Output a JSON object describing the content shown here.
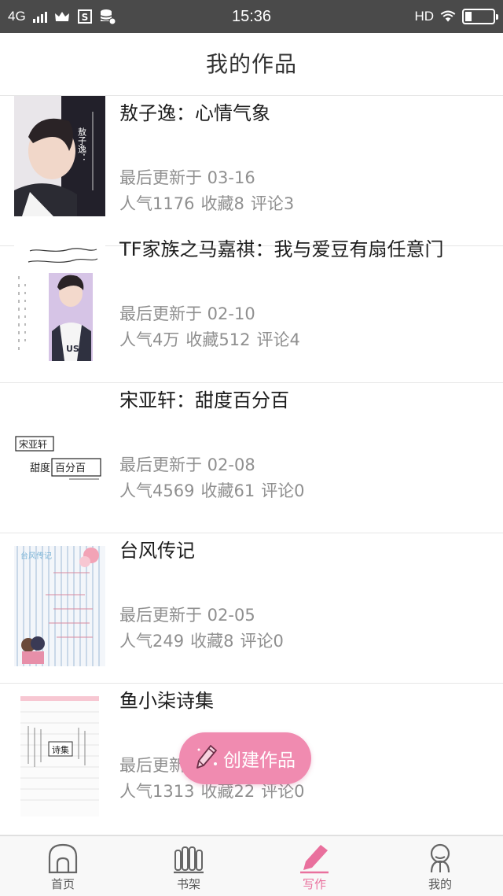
{
  "status_bar": {
    "network": "4G",
    "time": "15:36",
    "hd": "HD",
    "icons": [
      "signal-icon",
      "crown-icon",
      "s-app-icon",
      "database-icon",
      "wifi-icon",
      "battery-icon"
    ]
  },
  "header": {
    "title": "我的作品"
  },
  "works": [
    {
      "title": "敖子逸：心情气象",
      "updated": "最后更新于 03-16",
      "popularity": "人气1176",
      "favorites": "收藏8",
      "comments": "评论3",
      "cover_text": "敖子逸："
    },
    {
      "title": "TF家族之马嘉祺：我与爱豆有扇任意门",
      "updated": "最后更新于 02-10",
      "popularity": "人气4万",
      "favorites": "收藏512",
      "comments": "评论4",
      "cover_text": "US"
    },
    {
      "title": "宋亚轩：甜度百分百",
      "updated": "最后更新于 02-08",
      "popularity": "人气4569",
      "favorites": "收藏61",
      "comments": "评论0",
      "cover_text_1": "宋亚轩",
      "cover_text_2": "甜度",
      "cover_text_3": "百分百"
    },
    {
      "title": "台风传记",
      "updated": "最后更新于 02-05",
      "popularity": "人气249",
      "favorites": "收藏8",
      "comments": "评论0",
      "cover_text": "台风传记"
    },
    {
      "title": "鱼小柒诗集",
      "updated": "最后更新于",
      "popularity": "人气1313",
      "favorites": "收藏22",
      "comments": "评论0",
      "cover_text": "诗集"
    }
  ],
  "fab": {
    "label": "创建作品",
    "icon": "pencil-icon",
    "color": "#f08bb0"
  },
  "tabs": [
    {
      "label": "首页",
      "icon": "home-icon",
      "active": false
    },
    {
      "label": "书架",
      "icon": "bookshelf-icon",
      "active": false
    },
    {
      "label": "写作",
      "icon": "pen-icon",
      "active": true
    },
    {
      "label": "我的",
      "icon": "profile-icon",
      "active": false
    }
  ],
  "colors": {
    "accent": "#e9709d",
    "status_bar": "#4a4a4a",
    "muted_text": "#8f8f8f"
  }
}
